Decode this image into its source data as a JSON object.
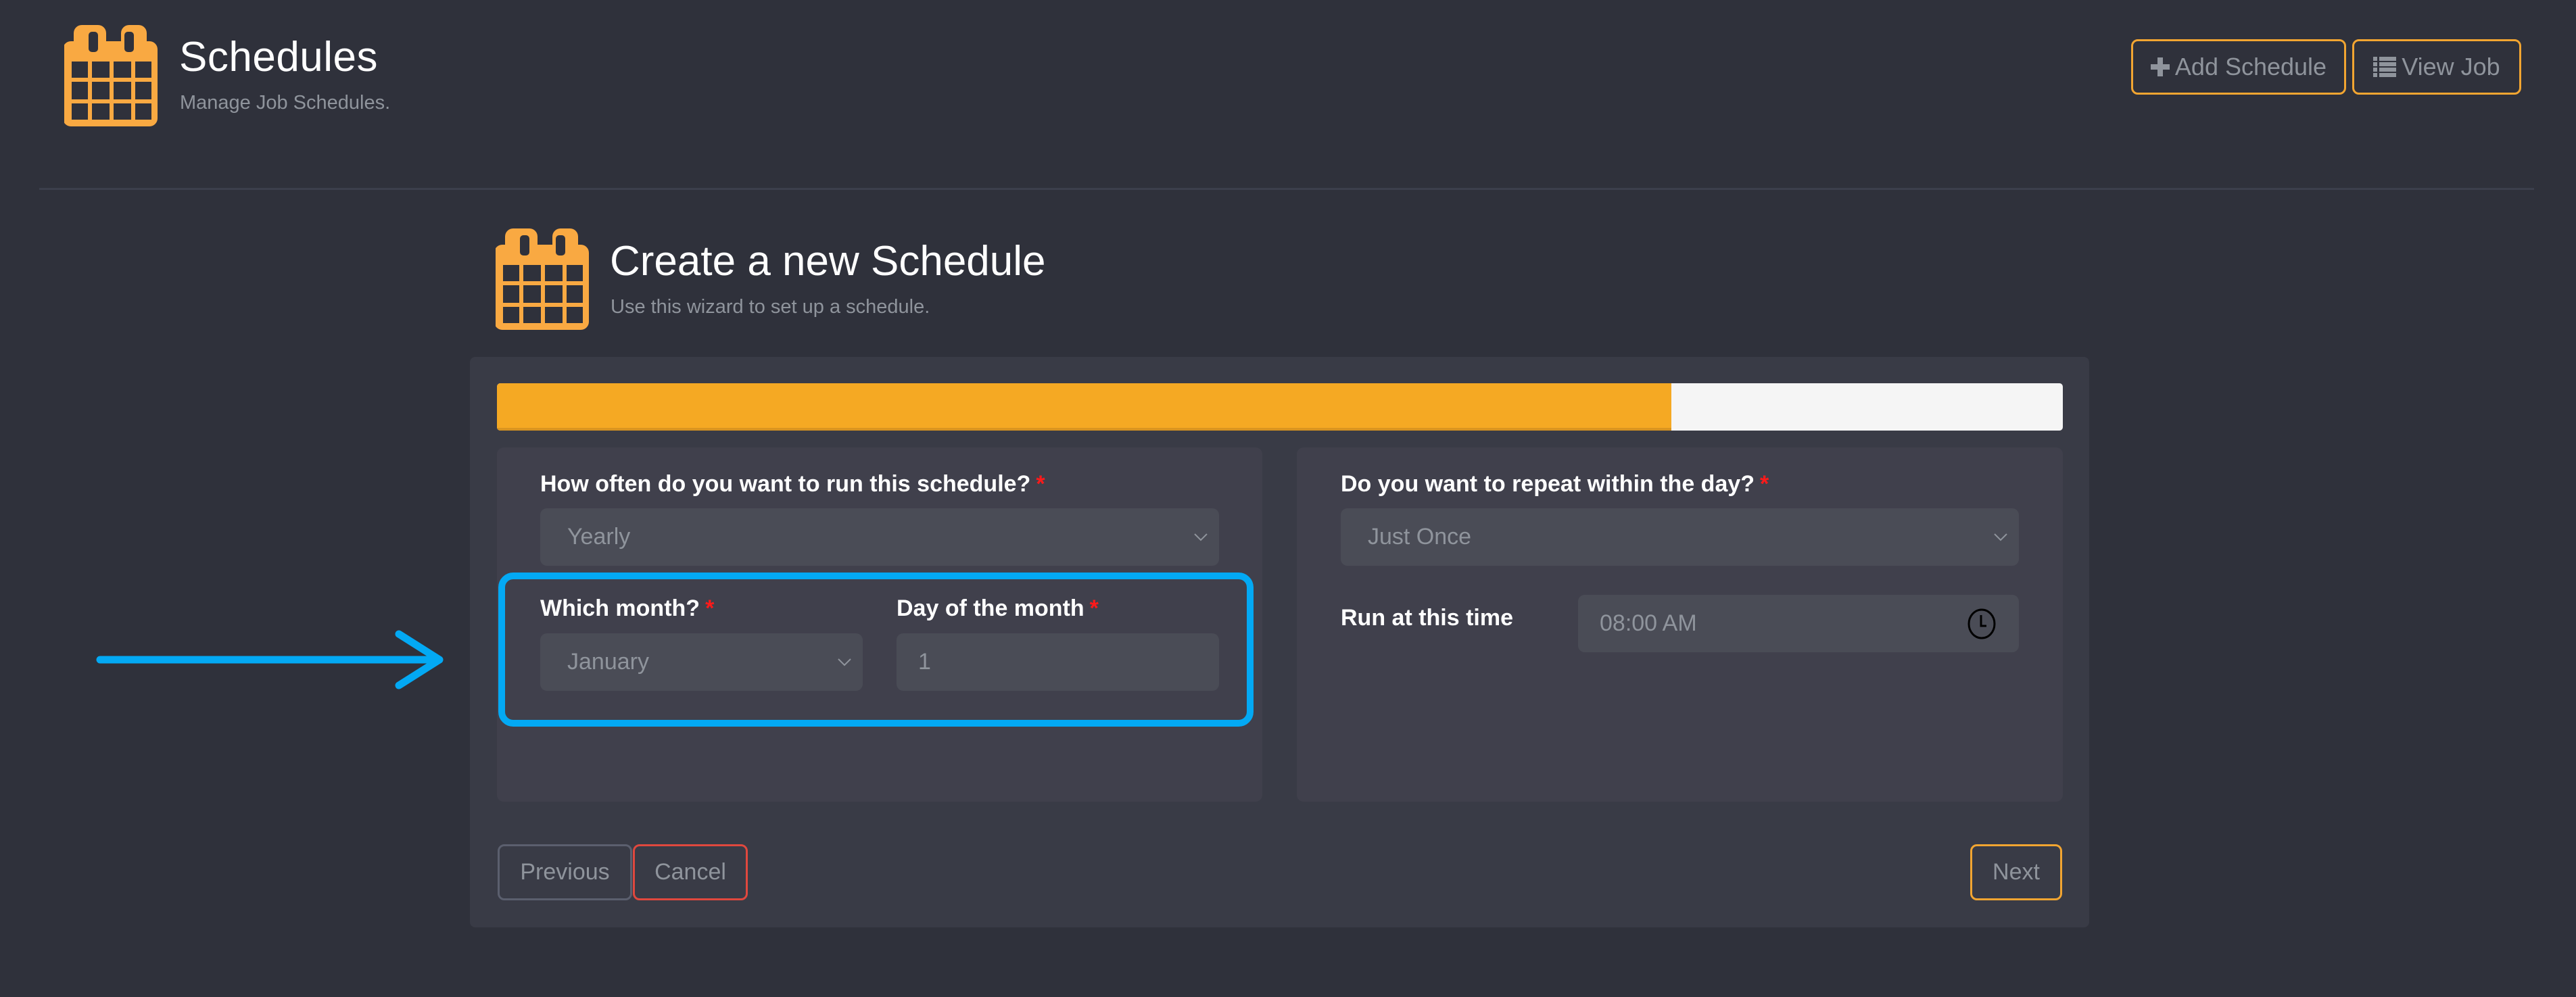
{
  "header": {
    "icon": "calendar-icon",
    "title": "Schedules",
    "subtitle": "Manage Job Schedules.",
    "buttons": [
      {
        "label": "Add Schedule",
        "icon": "plus-icon"
      },
      {
        "label": "View Job",
        "icon": "list-icon"
      }
    ]
  },
  "wizard": {
    "icon": "calendar-icon",
    "title": "Create a new Schedule",
    "subtitle": "Use this wizard to set up a schedule.",
    "progress_percent": 75,
    "left_panel": {
      "frequency": {
        "label": "How often do you want to run this schedule?",
        "required_mark": "*",
        "value": "Yearly"
      },
      "month": {
        "label": "Which month?",
        "required_mark": "*",
        "value": "January"
      },
      "day": {
        "label": "Day of the month",
        "required_mark": "*",
        "value": "1"
      }
    },
    "right_panel": {
      "repeat": {
        "label": "Do you want to repeat within the day?",
        "required_mark": "*",
        "value": "Just Once"
      },
      "time": {
        "label": "Run at this time",
        "value": "08:00 AM",
        "icon": "clock-icon"
      }
    },
    "footer": {
      "previous_label": "Previous",
      "cancel_label": "Cancel",
      "next_label": "Next"
    }
  },
  "annotation": {
    "arrow": "arrow-right-icon",
    "highlight_color": "#03a9f4"
  },
  "colors": {
    "accent": "#f5a923",
    "danger": "#e0483e",
    "background": "#2f313b",
    "card": "#393b46",
    "panel": "#40404c"
  }
}
